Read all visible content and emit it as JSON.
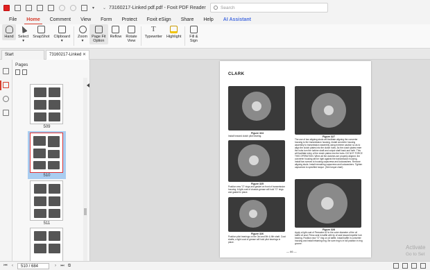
{
  "app": {
    "title": "73160217-Linked pdf.pdf - Foxit PDF Reader",
    "search_placeholder": "Search"
  },
  "menu": [
    "File",
    "Home",
    "Comment",
    "View",
    "Form",
    "Protect",
    "Foxit eSign",
    "Share",
    "Help",
    "AI Assistant"
  ],
  "ribbon": {
    "hand": "Hand",
    "select": "Select",
    "snapshot": "SnapShot",
    "clipboard": "Clipboard",
    "zoom": "Zoom",
    "page_fit_1": "Page Fit",
    "page_fit_2": "Option",
    "reflow": "Reflow",
    "rotate_1": "Rotate",
    "rotate_2": "View",
    "typewriter": "Typewriter",
    "highlight": "Highlight",
    "fill_sign_1": "Fill &",
    "fill_sign_2": "Sign"
  },
  "tabs": {
    "start": "Start",
    "document": "73160217-Linked pdf..."
  },
  "pages_panel": {
    "title": "Pages",
    "thumbs": [
      {
        "label": "509"
      },
      {
        "label": "510"
      },
      {
        "label": "511"
      }
    ]
  },
  "document": {
    "header": "CLARK",
    "figures": [
      {
        "title": "Figure 324",
        "text": "Install forward clutch pilot bearing."
      },
      {
        "title": "Figure 327",
        "text": "The use of two aligning studs will facilitate aligning the converter housing to the transmission housing. Install converter housing assembly to transmission assembly using extreme caution so as to align the clutch plates into the clutch hubs. As the clutch plates enter the hubs turn the turbine shaft and output shaft back and forth. This will facilitate entry of the clutch plates into the hubs. DO NOT FORCE THIS OPERATION. When all the clutches are properly aligned, the converter housing will be right against the transmission housing. Install two screws to housing capscrews and lockwashers. Remove aligning studs. Install remaining capscrews and lockwashers. Tighten capscrews to specified torque. (See torque chart)"
      },
      {
        "title": "Figure 325",
        "text": "Position new \"O\" rings and gasket on front of transmission housing. A light coat of chassis grease will hold \"O\" rings and gasket in place."
      },
      {
        "title": "Figure 328",
        "text": "Apply a light coat of Permatex #2 to the outer diameter of the oil baffle oil seal. Press seal in baffle with lip of seal toward impeller hub bearing. Position new \"O\" ring on oil baffle. Install baffle in converter housing and install retaining ring. Be sure ring is in full position in ring groove."
      },
      {
        "title": "Figure 326",
        "text": "Position pilot bearings on the 3rd and 5th & 6th shaft. Coat shafts, a light coat of grease will hold pilot bearings in place."
      }
    ],
    "page_footer": "— 66 —"
  },
  "watermark": {
    "line1": "Activate",
    "line2": "Go to Set"
  },
  "status": {
    "page_box": "510 / 684"
  }
}
